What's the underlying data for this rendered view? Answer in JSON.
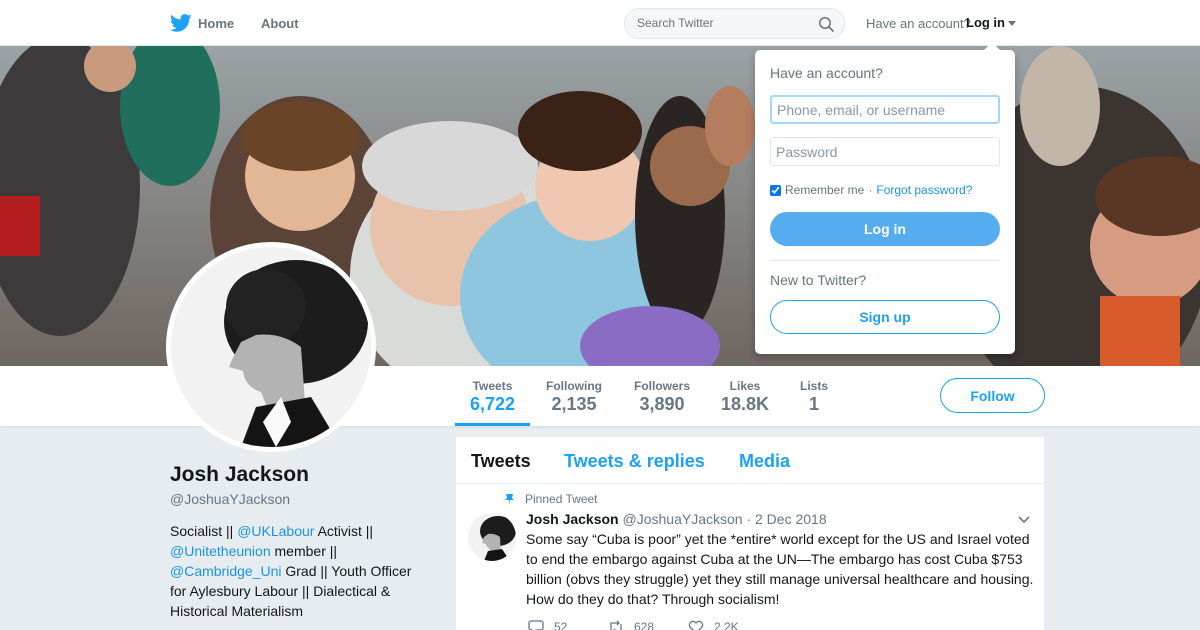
{
  "topnav": {
    "home_label": "Home",
    "about_label": "About",
    "search_placeholder": "Search Twitter",
    "have_account": "Have an account?",
    "login_label": "Log in"
  },
  "colors": {
    "accent": "#1da1f2",
    "login_button": "#55acee",
    "background": "#e6ecf0"
  },
  "profile": {
    "name": "Josh Jackson",
    "handle": "@JoshuaYJackson",
    "bio": {
      "part1": "Socialist || ",
      "link1": "@UKLabour",
      "part2": " Activist || ",
      "link2": "@Unitetheunion",
      "part3": " member || ",
      "link3": "@Cambridge_Uni",
      "part4": " Grad || Youth Officer for Aylesbury Labour || Dialectical & Historical Materialism"
    }
  },
  "stats": [
    {
      "label": "Tweets",
      "value": "6,722"
    },
    {
      "label": "Following",
      "value": "2,135"
    },
    {
      "label": "Followers",
      "value": "3,890"
    },
    {
      "label": "Likes",
      "value": "18.8K"
    },
    {
      "label": "Lists",
      "value": "1"
    }
  ],
  "follow_label": "Follow",
  "timeline": {
    "tabs": [
      "Tweets",
      "Tweets & replies",
      "Media"
    ],
    "pinned_label": "Pinned Tweet",
    "tweet": {
      "author": "Josh Jackson",
      "handle": "@JoshuaYJackson",
      "date": "· 2 Dec 2018",
      "text": "Some say “Cuba is poor” yet the *entire* world except for the US and Israel voted to end the embargo against Cuba at the UN—The embargo has cost Cuba $753 billion (obvs they struggle) yet they still manage universal healthcare and housing. How do they do that? Through socialism!",
      "replies": "52",
      "retweets": "628",
      "likes": "2.2K"
    }
  },
  "login_dropdown": {
    "title": "Have an account?",
    "username_placeholder": "Phone, email, or username",
    "password_placeholder": "Password",
    "remember_me": "Remember me",
    "separator": "·",
    "forgot_password": "Forgot password?",
    "login_button": "Log in",
    "new_to_twitter": "New to Twitter?",
    "signup_button": "Sign up"
  }
}
